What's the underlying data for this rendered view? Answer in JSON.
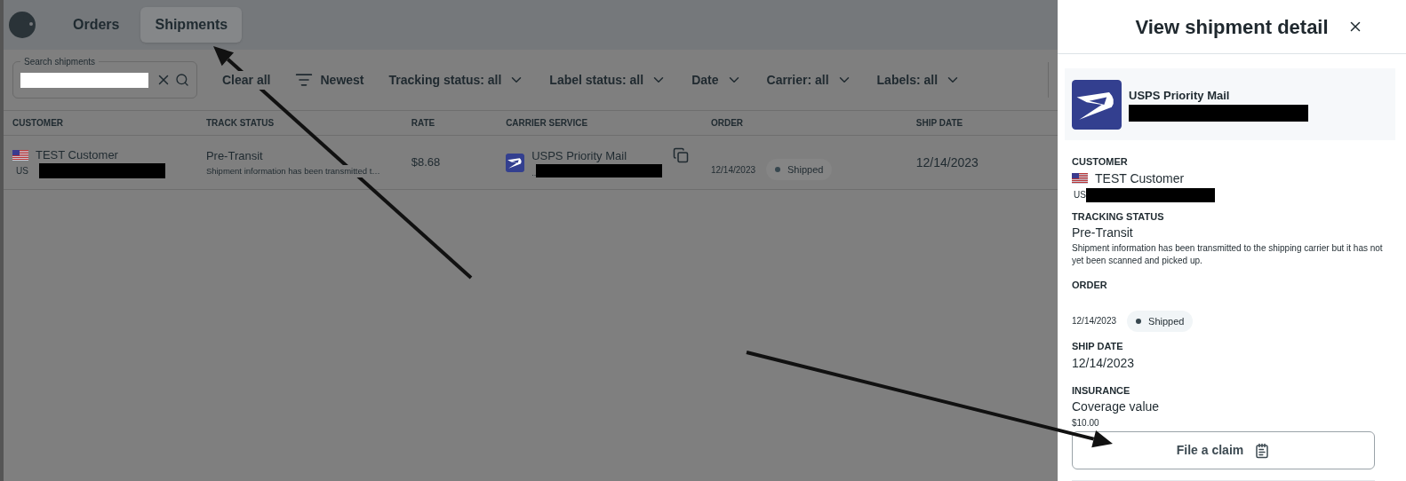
{
  "nav": {
    "tabs": [
      {
        "label": "Orders",
        "selected": false
      },
      {
        "label": "Shipments",
        "selected": true
      }
    ]
  },
  "search": {
    "label": "Search shipments"
  },
  "filters": [
    {
      "kind": "clear",
      "label": "Clear all"
    },
    {
      "kind": "sort",
      "label": "Newest"
    },
    {
      "kind": "dropdown",
      "label": "Tracking status: all"
    },
    {
      "kind": "dropdown",
      "label": "Label status: all"
    },
    {
      "kind": "dropdown",
      "label": "Date"
    },
    {
      "kind": "dropdown",
      "label": "Carrier: all"
    },
    {
      "kind": "dropdown",
      "label": "Labels: all"
    }
  ],
  "table": {
    "columns": [
      "CUSTOMER",
      "TRACK STATUS",
      "RATE",
      "CARRIER SERVICE",
      "ORDER",
      "SHIP DATE"
    ],
    "rows": [
      {
        "customer": "TEST Customer",
        "country": "US",
        "track_status": "Pre-Transit",
        "track_detail": "Shipment information has been transmitted t…",
        "rate": "$8.68",
        "carrier_service": "USPS Priority Mail",
        "carrier_prefix": "..",
        "order_date": "12/14/2023",
        "order_status": "Shipped",
        "ship_date": "12/14/2023"
      }
    ]
  },
  "detail": {
    "title": "View shipment detail",
    "carrier_service": "USPS Priority Mail",
    "sections": [
      {
        "kind": "customer",
        "heading": "CUSTOMER",
        "name": "TEST Customer",
        "country": "US"
      },
      {
        "kind": "tracking",
        "heading": "TRACKING STATUS",
        "status": "Pre-Transit",
        "description": "Shipment information has been transmitted to the shipping carrier but it has not yet been scanned and picked up."
      },
      {
        "kind": "order",
        "heading": "ORDER",
        "date": "12/14/2023",
        "status": "Shipped"
      },
      {
        "kind": "date",
        "heading": "SHIP DATE",
        "value": "12/14/2023"
      },
      {
        "kind": "insurance",
        "heading": "INSURANCE",
        "label": "Coverage value",
        "value": "$10.00"
      }
    ],
    "claim_button": "File a claim"
  }
}
